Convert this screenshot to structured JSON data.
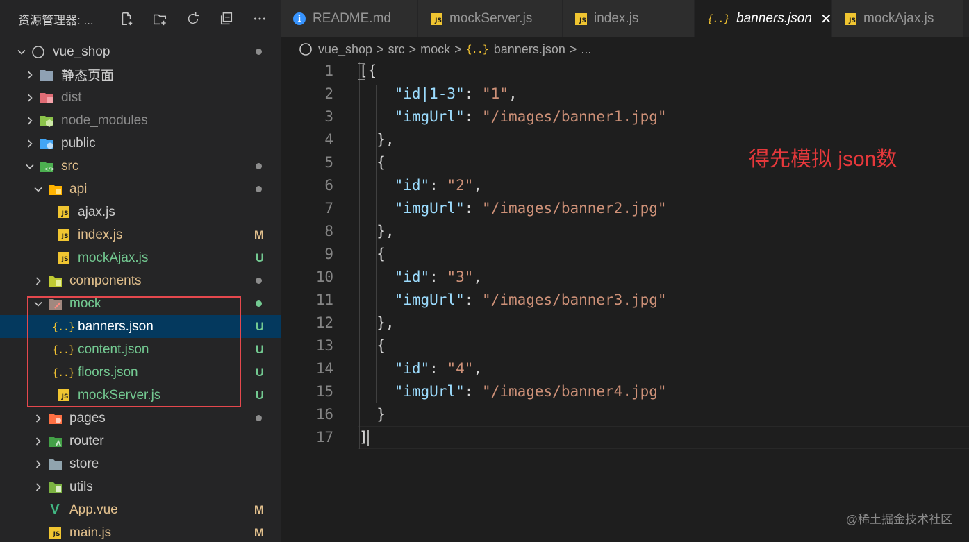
{
  "explorer": {
    "title": "资源管理器: ...",
    "actions": [
      "new-file-icon",
      "new-folder-icon",
      "refresh-icon",
      "collapse-all-icon",
      "more-icon"
    ]
  },
  "tree": [
    {
      "label": "vue_shop",
      "depth": 0,
      "expanded": true,
      "icon": "root-circle-icon",
      "status": "dot",
      "status_color": "#8c8c8c",
      "label_color": "#cccccc"
    },
    {
      "label": "静态页面",
      "depth": 1,
      "expanded": false,
      "icon": "folder-icon",
      "status": "",
      "label_color": "#cccccc"
    },
    {
      "label": "dist",
      "depth": 1,
      "expanded": false,
      "icon": "dist-folder-icon",
      "status": "",
      "label_color": "#8c8c8c"
    },
    {
      "label": "node_modules",
      "depth": 1,
      "expanded": false,
      "icon": "node-folder-icon",
      "status": "",
      "label_color": "#8c8c8c"
    },
    {
      "label": "public",
      "depth": 1,
      "expanded": false,
      "icon": "public-folder-icon",
      "status": "",
      "label_color": "#cccccc"
    },
    {
      "label": "src",
      "depth": 1,
      "expanded": true,
      "icon": "src-folder-icon",
      "status": "dot",
      "status_color": "#8c8c8c",
      "label_color": "#e2c08d"
    },
    {
      "label": "api",
      "depth": 2,
      "expanded": true,
      "icon": "api-folder-icon",
      "status": "dot",
      "status_color": "#8c8c8c",
      "label_color": "#e2c08d"
    },
    {
      "label": "ajax.js",
      "depth": 3,
      "icon": "js-file-icon",
      "status": "",
      "label_color": "#cccccc"
    },
    {
      "label": "index.js",
      "depth": 3,
      "icon": "js-file-icon",
      "status": "M",
      "status_color": "#e2c08d",
      "label_color": "#e2c08d"
    },
    {
      "label": "mockAjax.js",
      "depth": 3,
      "icon": "js-file-icon",
      "status": "U",
      "status_color": "#73c991",
      "label_color": "#73c991"
    },
    {
      "label": "components",
      "depth": 2,
      "expanded": false,
      "icon": "components-folder-icon",
      "status": "dot",
      "status_color": "#8c8c8c",
      "label_color": "#e2c08d"
    },
    {
      "label": "mock",
      "depth": 2,
      "expanded": true,
      "icon": "mock-folder-icon",
      "status": "dot",
      "status_color": "#73c991",
      "label_color": "#73c991"
    },
    {
      "label": "banners.json",
      "depth": 3,
      "icon": "json-file-icon",
      "status": "U",
      "status_color": "#73c991",
      "label_color": "#ffffff",
      "selected": true
    },
    {
      "label": "content.json",
      "depth": 3,
      "icon": "json-file-icon",
      "status": "U",
      "status_color": "#73c991",
      "label_color": "#73c991"
    },
    {
      "label": "floors.json",
      "depth": 3,
      "icon": "json-file-icon",
      "status": "U",
      "status_color": "#73c991",
      "label_color": "#73c991"
    },
    {
      "label": "mockServer.js",
      "depth": 3,
      "icon": "js-file-icon",
      "status": "U",
      "status_color": "#73c991",
      "label_color": "#73c991"
    },
    {
      "label": "pages",
      "depth": 2,
      "expanded": false,
      "icon": "pages-folder-icon",
      "status": "dot",
      "status_color": "#8c8c8c",
      "label_color": "#cccccc"
    },
    {
      "label": "router",
      "depth": 2,
      "expanded": false,
      "icon": "router-folder-icon",
      "status": "",
      "label_color": "#cccccc"
    },
    {
      "label": "store",
      "depth": 2,
      "expanded": false,
      "icon": "store-folder-icon",
      "status": "",
      "label_color": "#cccccc"
    },
    {
      "label": "utils",
      "depth": 2,
      "expanded": false,
      "icon": "utils-folder-icon",
      "status": "",
      "label_color": "#cccccc"
    },
    {
      "label": "App.vue",
      "depth": 2,
      "icon": "vue-file-icon",
      "status": "M",
      "status_color": "#e2c08d",
      "label_color": "#e2c08d"
    },
    {
      "label": "main.js",
      "depth": 2,
      "icon": "js-file-icon",
      "status": "M",
      "status_color": "#e2c08d",
      "label_color": "#e2c08d"
    }
  ],
  "tabs": [
    {
      "label": "README.md",
      "icon": "info-icon",
      "active": false
    },
    {
      "label": "mockServer.js",
      "icon": "js-file-icon",
      "active": false
    },
    {
      "label": "index.js",
      "icon": "js-file-icon",
      "active": false
    },
    {
      "label": "banners.json",
      "icon": "json-file-icon",
      "active": true,
      "close": "✕"
    },
    {
      "label": "mockAjax.js",
      "icon": "js-file-icon",
      "active": false
    }
  ],
  "breadcrumb": {
    "root": "vue_shop",
    "parts": [
      "src",
      "mock"
    ],
    "file": "banners.json",
    "ellipsis": "...",
    "separator": ">"
  },
  "editor": {
    "lines": [
      [
        {
          "t": "p",
          "v": "[{"
        }
      ],
      [
        {
          "t": "p",
          "v": "    "
        },
        {
          "t": "k",
          "v": "\"id|1-3\""
        },
        {
          "t": "p",
          "v": ": "
        },
        {
          "t": "s",
          "v": "\"1\""
        },
        {
          "t": "p",
          "v": ","
        }
      ],
      [
        {
          "t": "p",
          "v": "    "
        },
        {
          "t": "k",
          "v": "\"imgUrl\""
        },
        {
          "t": "p",
          "v": ": "
        },
        {
          "t": "s",
          "v": "\"/images/banner1.jpg\""
        }
      ],
      [
        {
          "t": "p",
          "v": "  },"
        }
      ],
      [
        {
          "t": "p",
          "v": "  {"
        }
      ],
      [
        {
          "t": "p",
          "v": "    "
        },
        {
          "t": "k",
          "v": "\"id\""
        },
        {
          "t": "p",
          "v": ": "
        },
        {
          "t": "s",
          "v": "\"2\""
        },
        {
          "t": "p",
          "v": ","
        }
      ],
      [
        {
          "t": "p",
          "v": "    "
        },
        {
          "t": "k",
          "v": "\"imgUrl\""
        },
        {
          "t": "p",
          "v": ": "
        },
        {
          "t": "s",
          "v": "\"/images/banner2.jpg\""
        }
      ],
      [
        {
          "t": "p",
          "v": "  },"
        }
      ],
      [
        {
          "t": "p",
          "v": "  {"
        }
      ],
      [
        {
          "t": "p",
          "v": "    "
        },
        {
          "t": "k",
          "v": "\"id\""
        },
        {
          "t": "p",
          "v": ": "
        },
        {
          "t": "s",
          "v": "\"3\""
        },
        {
          "t": "p",
          "v": ","
        }
      ],
      [
        {
          "t": "p",
          "v": "    "
        },
        {
          "t": "k",
          "v": "\"imgUrl\""
        },
        {
          "t": "p",
          "v": ": "
        },
        {
          "t": "s",
          "v": "\"/images/banner3.jpg\""
        }
      ],
      [
        {
          "t": "p",
          "v": "  },"
        }
      ],
      [
        {
          "t": "p",
          "v": "  {"
        }
      ],
      [
        {
          "t": "p",
          "v": "    "
        },
        {
          "t": "k",
          "v": "\"id\""
        },
        {
          "t": "p",
          "v": ": "
        },
        {
          "t": "s",
          "v": "\"4\""
        },
        {
          "t": "p",
          "v": ","
        }
      ],
      [
        {
          "t": "p",
          "v": "    "
        },
        {
          "t": "k",
          "v": "\"imgUrl\""
        },
        {
          "t": "p",
          "v": ": "
        },
        {
          "t": "s",
          "v": "\"/images/banner4.jpg\""
        }
      ],
      [
        {
          "t": "p",
          "v": "  }"
        }
      ],
      [
        {
          "t": "p",
          "v": "]"
        }
      ]
    ]
  },
  "annotation": "得先模拟 json数",
  "watermark": "@稀土掘金技术社区",
  "colors": {
    "sidebar_bg": "#252526",
    "editor_bg": "#1e1e1e",
    "selection_bg": "#04395e",
    "highlight_box": "#e5484d",
    "annotation_text": "#e5383b",
    "json_key": "#9cdcfe",
    "json_string": "#ce9178"
  }
}
